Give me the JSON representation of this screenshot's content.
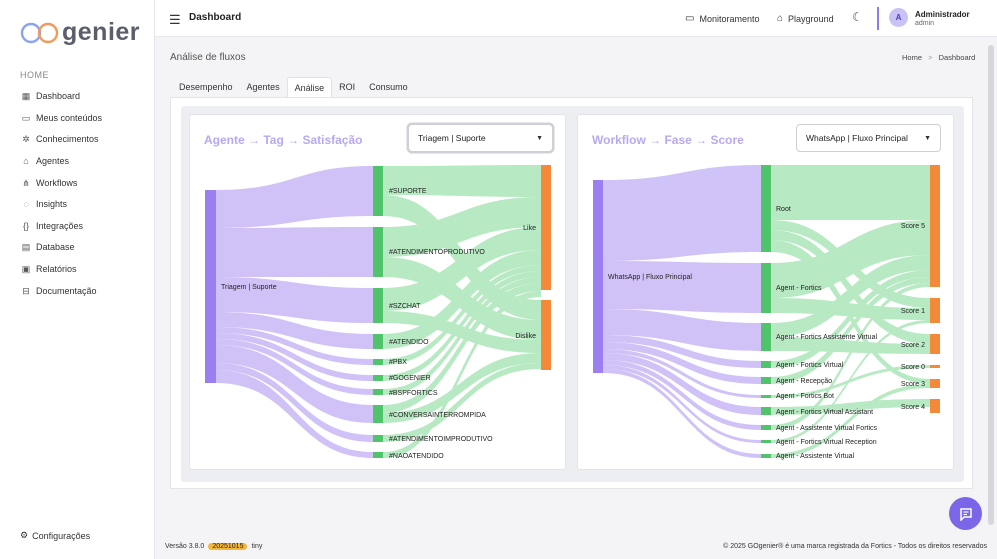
{
  "brand": {
    "logo_prefix": "GO",
    "logo_text": "genier"
  },
  "sidebar": {
    "section": "HOME",
    "items": [
      {
        "label": "Dashboard",
        "icon": "grid-icon"
      },
      {
        "label": "Meus conteúdos",
        "icon": "folder-icon"
      },
      {
        "label": "Conhecimentos",
        "icon": "bulb-icon"
      },
      {
        "label": "Agentes",
        "icon": "robot-icon"
      },
      {
        "label": "Workflows",
        "icon": "flow-icon"
      },
      {
        "label": "Insights",
        "icon": "insight-icon"
      },
      {
        "label": "Integrações",
        "icon": "braces-icon"
      },
      {
        "label": "Database",
        "icon": "database-icon"
      },
      {
        "label": "Relatórios",
        "icon": "report-icon"
      },
      {
        "label": "Documentação",
        "icon": "book-icon"
      }
    ],
    "settings": "Configurações"
  },
  "topbar": {
    "title": "Dashboard",
    "monitor": "Monitoramento",
    "playground": "Playground",
    "avatar_initial": "A",
    "user_name": "Administrador",
    "user_role": "admin"
  },
  "page": {
    "title": "Análise de fluxos",
    "breadcrumb_home": "Home",
    "breadcrumb_sep": ">",
    "breadcrumb_current": "Dashboard"
  },
  "tabs": [
    "Desempenho",
    "Agentes",
    "Análise",
    "ROI",
    "Consumo"
  ],
  "left_chart": {
    "title": "Agente → Tag → Satisfação",
    "select_value": "Triagem | Suporte",
    "source": "Triagem | Suporte",
    "tags": [
      "#SUPORTE",
      "#ATENDIMENTOPRODUTIVO",
      "#SZCHAT",
      "#ATENDIDO",
      "#PBX",
      "#GOGENIER",
      "#BSPFORTICS",
      "#CONVERSAINTERROMPIDA",
      "#ATENDIMENTOIMPRODUTIVO",
      "#NAOATENDIDO"
    ],
    "targets": [
      "Like",
      "Dislike"
    ]
  },
  "right_chart": {
    "title": "Workflow → Fase → Score",
    "select_value": "WhatsApp | Fluxo Principal",
    "source": "WhatsApp | Fluxo Principal",
    "phases": [
      "Root",
      "Agent - Fortics",
      "Agent - Fortics Assistente Virtual",
      "Agent - Fortics Virtual",
      "Agent - Recepção",
      "Agent - Fortics Bot",
      "Agent - Fortics Virtual Assistant",
      "Agent - Assistente Virtual Fortics",
      "Agent - Fortics Virtual Reception",
      "Agent - Assistente Virtual"
    ],
    "targets": [
      "Score 5",
      "Score 1",
      "Score 2",
      "Score 0",
      "Score 3",
      "Score 4"
    ]
  },
  "colors": {
    "source": "#9b7ef0",
    "middle": "#4fc46a",
    "target": "#f5893a",
    "link_left": "#c8b8f6",
    "link_right": "#a6e4b5",
    "accent": "#7c66e8"
  },
  "footer": {
    "version": "Versão 3.8.0",
    "build": "20251015",
    "tiny": "tiny",
    "copyright": "© 2025 GOgenier® é uma marca registrada da Fortics - Todos os direitos reservados"
  }
}
